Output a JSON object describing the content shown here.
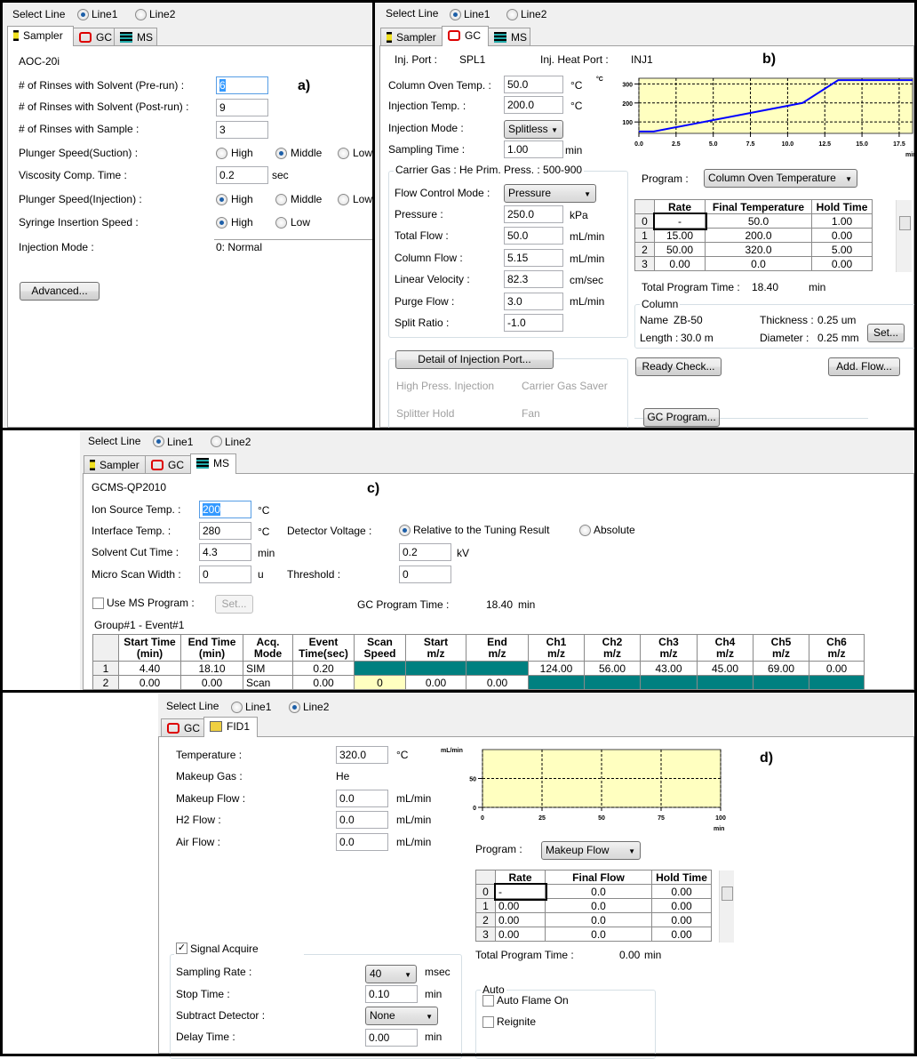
{
  "select_line": {
    "label": "Select Line",
    "line1": "Line1",
    "line2": "Line2"
  },
  "tabs": {
    "sampler": "Sampler",
    "gc": "GC",
    "ms": "MS",
    "fid": "FID1"
  },
  "panel_labels": {
    "a": "a)",
    "b": "b)",
    "c": "c)",
    "d": "d)"
  },
  "sampler": {
    "model": "AOC-20i",
    "rinse_pre_label": "# of Rinses with Solvent (Pre-run) :",
    "rinse_pre": "6",
    "rinse_post_label": "# of Rinses with Solvent (Post-run) :",
    "rinse_post": "9",
    "rinse_sample_label": "# of Rinses with Sample :",
    "rinse_sample": "3",
    "plunger_suction_label": "Plunger Speed(Suction) :",
    "viscosity_label": "Viscosity Comp. Time :",
    "viscosity": "0.2",
    "viscosity_unit": "sec",
    "plunger_injection_label": "Plunger Speed(Injection) :",
    "syringe_label": "Syringe Insertion Speed :",
    "injection_mode_label": "Injection Mode :",
    "injection_mode": "0: Normal",
    "high": "High",
    "middle": "Middle",
    "low": "Low",
    "suction_selected": "Middle",
    "injection_selected": "High",
    "syringe_selected": "High",
    "advanced_button": "Advanced..."
  },
  "gc": {
    "inj_port_label": "Inj. Port :",
    "inj_port": "SPL1",
    "inj_heat_port_label": "Inj. Heat Port :",
    "inj_heat_port": "INJ1",
    "oven_temp_label": "Column Oven Temp. :",
    "oven_temp": "50.0",
    "inj_temp_label": "Injection Temp. :",
    "inj_temp": "200.0",
    "degc": "°C",
    "inj_mode_label": "Injection Mode :",
    "inj_mode": "Splitless",
    "sampling_time_label": "Sampling Time :",
    "sampling_time": "1.00",
    "min": "min",
    "carrier_legend": "Carrier Gas : He    Prim. Press. : 500-900",
    "flow_mode_label": "Flow Control Mode :",
    "flow_mode": "Pressure",
    "pressure_label": "Pressure :",
    "pressure": "250.0",
    "pressure_unit": "kPa",
    "total_flow_label": "Total Flow :",
    "total_flow": "50.0",
    "column_flow_label": "Column Flow :",
    "column_flow": "5.15",
    "linear_velocity_label": "Linear Velocity :",
    "linear_velocity": "82.3",
    "velocity_unit": "cm/sec",
    "purge_flow_label": "Purge Flow :",
    "purge_flow": "3.0",
    "split_ratio_label": "Split Ratio :",
    "split_ratio": "-1.0",
    "flow_unit": "mL/min",
    "detail_button": "Detail of Injection Port...",
    "high_press": "High Press. Injection",
    "carrier_saver": "Carrier Gas Saver",
    "splitter_hold": "Splitter Hold",
    "fan": "Fan",
    "program_label": "Program :",
    "program": "Column Oven Temperature",
    "table": {
      "headers": [
        "Rate",
        "Final Temperature",
        "Hold Time"
      ],
      "rows": [
        [
          "0",
          "-",
          "50.0",
          "1.00"
        ],
        [
          "1",
          "15.00",
          "200.0",
          "0.00"
        ],
        [
          "2",
          "50.00",
          "320.0",
          "5.00"
        ],
        [
          "3",
          "0.00",
          "0.0",
          "0.00"
        ]
      ]
    },
    "total_time_label": "Total Program Time :",
    "total_time": "18.40",
    "column_legend": "Column",
    "col_name_label": "Name",
    "col_name": "ZB-50",
    "col_length_label": "Length :",
    "col_length": "30.0 m",
    "thickness_label": "Thickness :",
    "thickness": "0.25 um",
    "diameter_label": "Diameter :",
    "diameter": "0.25 mm",
    "set_button": "Set...",
    "ready_check_button": "Ready Check...",
    "add_flow_button": "Add. Flow...",
    "gc_program_button": "GC Program..."
  },
  "ms": {
    "model": "GCMS-QP2010",
    "ion_source_label": "Ion Source Temp. :",
    "ion_source": "200",
    "interface_label": "Interface Temp. :",
    "interface": "280",
    "degc": "°C",
    "solvent_cut_label": "Solvent Cut Time :",
    "solvent_cut": "4.3",
    "min": "min",
    "micro_scan_label": "Micro Scan Width :",
    "micro_scan": "0",
    "u": "u",
    "detector_label": "Detector Voltage :",
    "relative": "Relative to the Tuning Result",
    "absolute": "Absolute",
    "detector_selected": "Relative to the Tuning Result",
    "voltage": "0.2",
    "kv": "kV",
    "threshold_label": "Threshold :",
    "threshold": "0",
    "use_program_label": "Use MS Program :",
    "use_program_checked": false,
    "set_button": "Set...",
    "gc_time_label": "GC Program Time :",
    "gc_time": "18.40",
    "group_label": "Group#1 - Event#1",
    "table": {
      "headers": [
        "Start Time\n(min)",
        "End Time\n(min)",
        "Acq.\nMode",
        "Event\nTime(sec)",
        "Scan\nSpeed",
        "Start\nm/z",
        "End\nm/z",
        "Ch1\nm/z",
        "Ch2\nm/z",
        "Ch3\nm/z",
        "Ch4\nm/z",
        "Ch5\nm/z",
        "Ch6\nm/z"
      ],
      "rows": [
        [
          "1",
          "4.40",
          "18.10",
          "SIM",
          "0.20",
          null,
          null,
          null,
          "124.00",
          "56.00",
          "43.00",
          "45.00",
          "69.00",
          "0.00"
        ],
        [
          "2",
          "0.00",
          "0.00",
          "Scan",
          "0.00",
          "0",
          "0.00",
          "0.00",
          null,
          null,
          null,
          null,
          null,
          null
        ]
      ]
    },
    "disabled_cell_color": "#008080"
  },
  "fid": {
    "temp_label": "Temperature :",
    "temp": "320.0",
    "degc": "°C",
    "makeup_gas_label": "Makeup Gas :",
    "makeup_gas": "He",
    "makeup_flow_label": "Makeup Flow :",
    "makeup_flow": "0.0",
    "h2_label": "H2 Flow :",
    "h2": "0.0",
    "air_label": "Air Flow :",
    "air": "0.0",
    "flow_unit": "mL/min",
    "program_label": "Program :",
    "program": "Makeup Flow",
    "table": {
      "headers": [
        "Rate",
        "Final Flow",
        "Hold Time"
      ],
      "rows": [
        [
          "0",
          "-",
          "0.0",
          "0.00"
        ],
        [
          "1",
          "0.00",
          "0.0",
          "0.00"
        ],
        [
          "2",
          "0.00",
          "0.0",
          "0.00"
        ],
        [
          "3",
          "0.00",
          "0.0",
          "0.00"
        ]
      ]
    },
    "total_time_label": "Total Program Time :",
    "total_time": "0.00",
    "min": "min",
    "signal_acquire": "Signal Acquire",
    "signal_checked": true,
    "sampling_rate_label": "Sampling Rate :",
    "sampling_rate": "40",
    "msec": "msec",
    "stop_time_label": "Stop Time :",
    "stop_time": "0.10",
    "subtract_label": "Subtract Detector :",
    "subtract": "None",
    "delay_label": "Delay Time :",
    "delay": "0.00",
    "auto_legend": "Auto",
    "auto_flame": "Auto Flame On",
    "reignite": "Reignite"
  },
  "chart_data": [
    {
      "type": "line",
      "ylabel": "°C",
      "xlabel": "min",
      "xlim": [
        0,
        18.4
      ],
      "ylim": [
        40,
        330
      ],
      "xticks": [
        "0.0",
        "2.5",
        "5.0",
        "7.5",
        "10.0",
        "12.5",
        "15.0",
        "17.5"
      ],
      "yticks": [
        "100",
        "200",
        "300"
      ],
      "x": [
        0,
        1,
        11,
        13.4,
        18.4
      ],
      "y": [
        50,
        50,
        200,
        320,
        320
      ],
      "grid": true,
      "line_color": "#0000ff",
      "background": "#ffffc0"
    },
    {
      "type": "line",
      "ylabel": "mL/min",
      "xlabel": "min",
      "xlim": [
        0,
        100
      ],
      "ylim": [
        0,
        100
      ],
      "xticks": [
        "0",
        "25",
        "50",
        "75",
        "100"
      ],
      "yticks": [
        "0",
        "50"
      ],
      "x": [],
      "y": [],
      "grid": true,
      "background": "#ffffc0"
    }
  ]
}
